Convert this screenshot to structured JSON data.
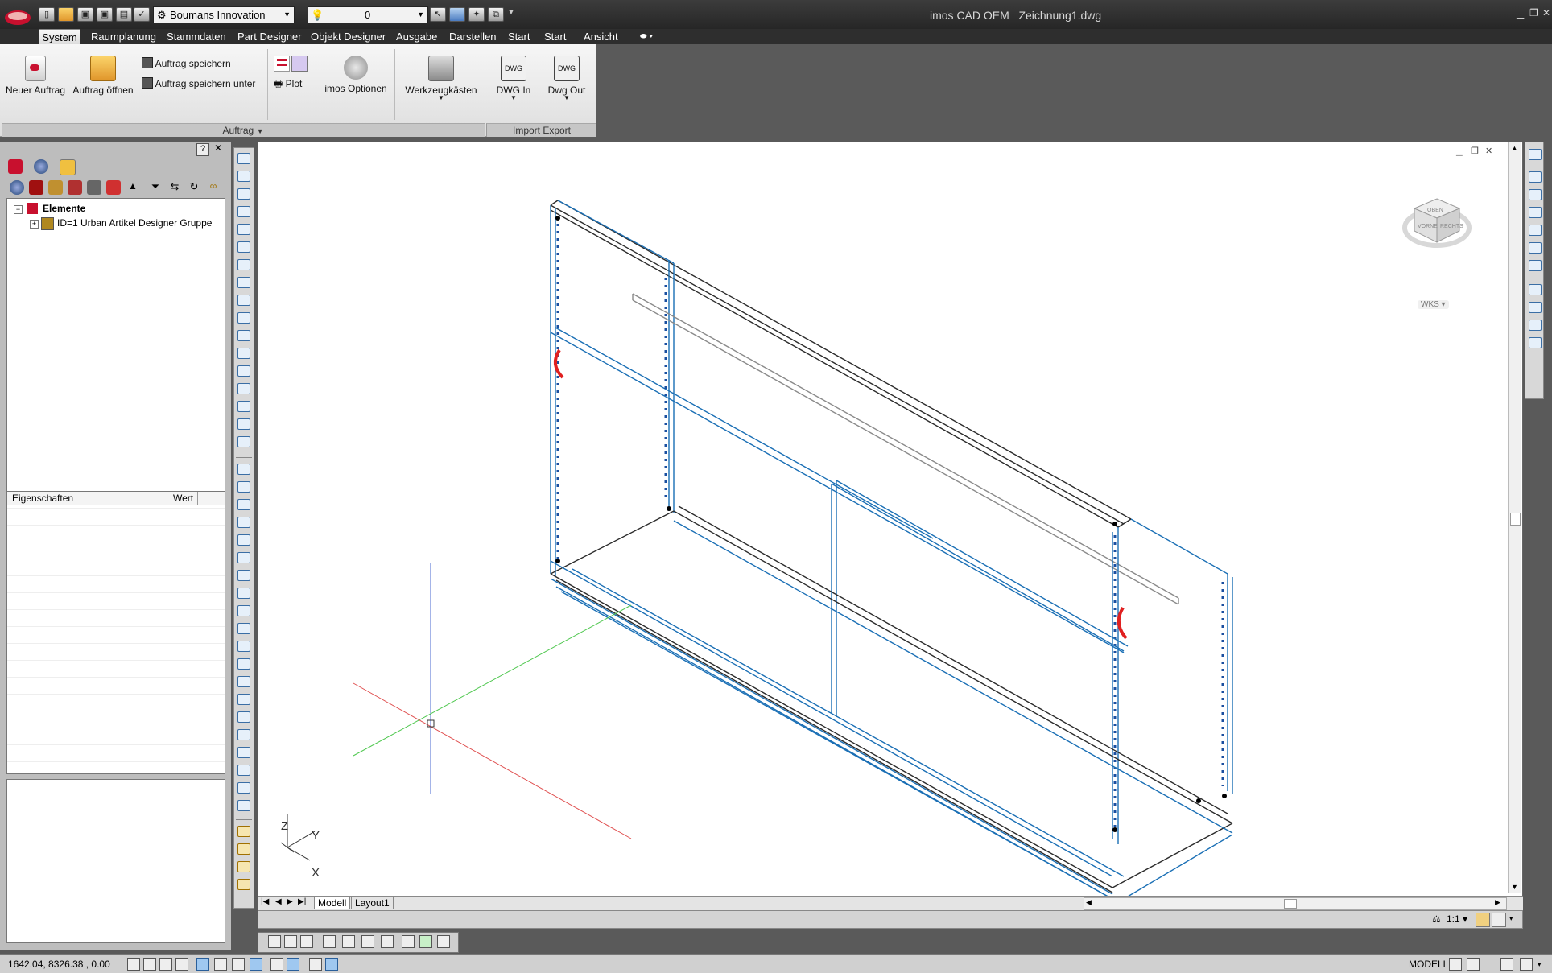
{
  "titlebar": {
    "app_title": "imos CAD OEM",
    "document": "Zeichnung1.dwg",
    "workspace_combo": "Boumans Innovation",
    "layer_combo": "0"
  },
  "menu_tabs": [
    {
      "label": "System",
      "active": true
    },
    {
      "label": "Raumplanung"
    },
    {
      "label": "Stammdaten"
    },
    {
      "label": "Part Designer"
    },
    {
      "label": "Objekt Designer"
    },
    {
      "label": "Ausgabe"
    },
    {
      "label": "Darstellen"
    },
    {
      "label": "Start"
    },
    {
      "label": "Start"
    },
    {
      "label": "Ansicht"
    }
  ],
  "ribbon": {
    "new_order": "Neuer Auftrag",
    "open_order": "Auftrag öffnen",
    "save_order": "Auftrag speichern",
    "save_order_as": "Auftrag speichern unter",
    "plot": "Plot",
    "imos_options": "imos Optionen",
    "toolboxes": "Werkzeugkästen",
    "dwg_in": "DWG In",
    "dwg_out": "Dwg Out",
    "dwg_icon_text": "DWG",
    "panel_auftrag": "Auftrag",
    "panel_import_export": "Import Export"
  },
  "left_palette": {
    "help_btn": "?",
    "close_btn": "✕",
    "tree_root": "Elemente",
    "tree_child": "ID=1 Urban Artikel Designer Gruppe",
    "prop_header_name": "Eigenschaften",
    "prop_header_value": "Wert"
  },
  "viewcube": {
    "top": "OBEN",
    "front": "VORNE",
    "right": "RECHTS",
    "wcs": "WKS"
  },
  "ucs": {
    "x": "X",
    "y": "Y",
    "z": "Z"
  },
  "layout_tabs": [
    "Modell",
    "Layout1"
  ],
  "annotation_scale": "1:1",
  "status": {
    "coords": "1642.04, 8326.38 , 0.00",
    "space": "MODELL"
  },
  "colors": {
    "cabinet_blue": "#1a6fb5",
    "handle_red": "#e02020",
    "axis_red": "#e05050",
    "axis_green": "#50c850",
    "axis_blue": "#4a6ad0",
    "frame_dark": "#2b2b2b"
  }
}
